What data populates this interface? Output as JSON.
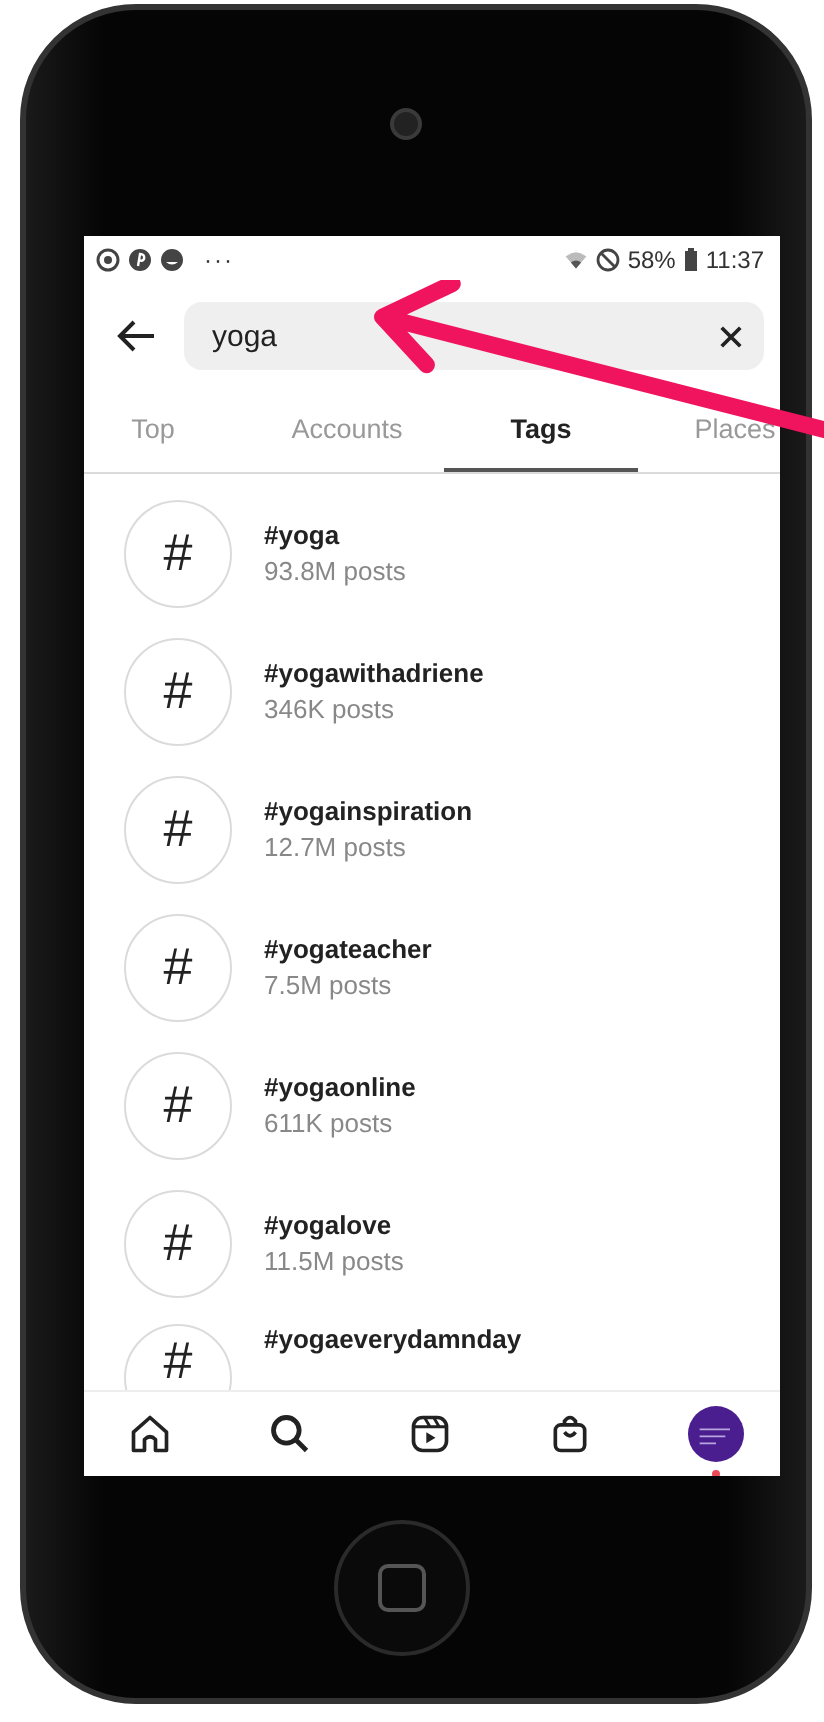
{
  "status_bar": {
    "notification_icons": "···",
    "battery": "58%",
    "time": "11:37"
  },
  "search": {
    "value": "yoga"
  },
  "tabs": [
    {
      "label": "Top",
      "selected": false
    },
    {
      "label": "Accounts",
      "selected": false
    },
    {
      "label": "Tags",
      "selected": true
    },
    {
      "label": "Places",
      "selected": false
    }
  ],
  "results": [
    {
      "icon": "#",
      "name": "#yoga",
      "posts": "93.8M posts"
    },
    {
      "icon": "#",
      "name": "#yogawithadriene",
      "posts": "346K posts"
    },
    {
      "icon": "#",
      "name": "#yogainspiration",
      "posts": "12.7M posts"
    },
    {
      "icon": "#",
      "name": "#yogateacher",
      "posts": "7.5M posts"
    },
    {
      "icon": "#",
      "name": "#yogaonline",
      "posts": "611K posts"
    },
    {
      "icon": "#",
      "name": "#yogalove",
      "posts": "11.5M posts"
    },
    {
      "icon": "#",
      "name": "#yogaeverydamnday"
    }
  ],
  "bottom_nav": {
    "profile_notification": true
  }
}
